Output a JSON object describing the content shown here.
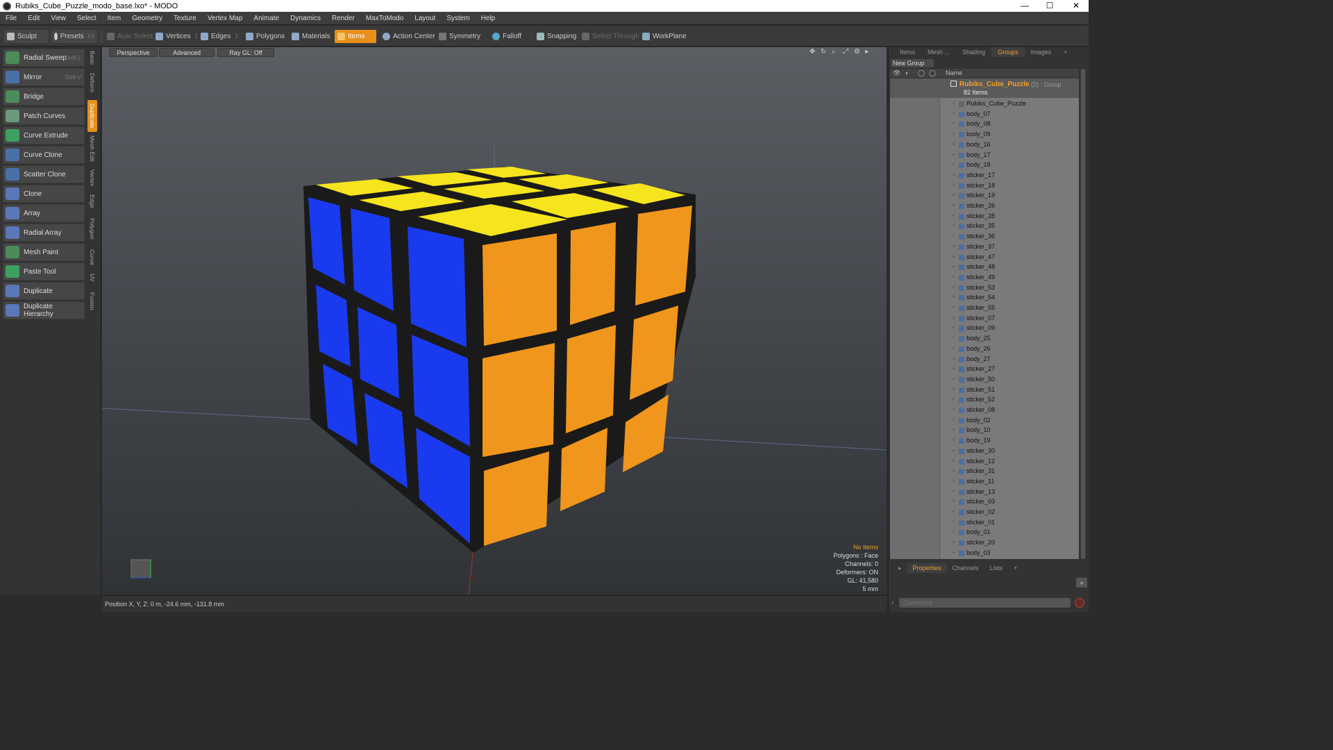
{
  "window": {
    "title": "Rubiks_Cube_Puzzle_modo_base.lxo* - MODO",
    "minimize": "—",
    "maximize": "☐",
    "close": "✕"
  },
  "menu": [
    "File",
    "Edit",
    "View",
    "Select",
    "Item",
    "Geometry",
    "Texture",
    "Vertex Map",
    "Animate",
    "Dynamics",
    "Render",
    "MaxToModo",
    "Layout",
    "System",
    "Help"
  ],
  "toolbar": {
    "sculpt": "Sculpt",
    "presets": "Presets",
    "presets_key": "F6",
    "auto_select": "Auto Select",
    "vertices": "Vertices",
    "vertices_key": "1",
    "edges": "Edges",
    "edges_key": "2",
    "polygons": "Polygons",
    "materials": "Materials",
    "items": "Items",
    "action_center": "Action Center",
    "symmetry": "Symmetry",
    "falloff": "Falloff",
    "snapping": "Snapping",
    "select_through": "Select Through",
    "workplane": "WorkPlane"
  },
  "tools": [
    {
      "label": "Radial Sweep",
      "shortcut": "Shift-L"
    },
    {
      "label": "Mirror",
      "shortcut": "Shift-V"
    },
    {
      "label": "Bridge",
      "shortcut": ""
    },
    {
      "label": "Patch Curves",
      "shortcut": ""
    },
    {
      "label": "Curve Extrude",
      "shortcut": ""
    },
    {
      "label": "Curve Clone",
      "shortcut": ""
    },
    {
      "label": "Scatter Clone",
      "shortcut": ""
    },
    {
      "label": "Clone",
      "shortcut": ""
    },
    {
      "label": "Array",
      "shortcut": ""
    },
    {
      "label": "Radial Array",
      "shortcut": ""
    },
    {
      "label": "Mesh Paint",
      "shortcut": ""
    },
    {
      "label": "Paste Tool",
      "shortcut": ""
    },
    {
      "label": "Duplicate",
      "shortcut": ""
    },
    {
      "label": "Duplicate Hierarchy",
      "shortcut": ""
    }
  ],
  "vertical_tabs": [
    "Basic",
    "Deform",
    "Duplicate",
    "Mesh Edit",
    "Vertex",
    "Edge",
    "Polygon",
    "Curve",
    "UV",
    "Fusion"
  ],
  "viewport": {
    "view": "Perspective",
    "shading": "Advanced",
    "raygl": "Ray GL: Off",
    "hud": {
      "selection": "No Items",
      "polygons": "Polygons : Face",
      "channels": "Channels: 0",
      "deformers": "Deformers: ON",
      "gl": "GL: 41,580",
      "scale": "5 mm"
    }
  },
  "status": {
    "position": "Position X, Y, Z:  0 m, -24.6 mm, -131.8 mm"
  },
  "right_tabs": [
    "Items",
    "Mesh ...",
    "Shading",
    "Groups",
    "Images",
    "+"
  ],
  "groups": {
    "new_group": "New Group",
    "column_name": "Name",
    "group_name": "Rubiks_Cube_Puzzle",
    "group_suffix": "(2) : Group",
    "count": "82 Items",
    "items": [
      "Rubiks_Cube_Puzzle",
      "body_07",
      "body_08",
      "body_09",
      "body_16",
      "body_17",
      "body_18",
      "sticker_17",
      "sticker_18",
      "sticker_19",
      "sticker_26",
      "sticker_28",
      "sticker_35",
      "sticker_36",
      "sticker_37",
      "sticker_47",
      "sticker_48",
      "sticker_49",
      "sticker_53",
      "sticker_54",
      "sticker_55",
      "sticker_07",
      "sticker_09",
      "body_25",
      "body_26",
      "body_27",
      "sticker_27",
      "sticker_50",
      "sticker_51",
      "sticker_52",
      "sticker_08",
      "body_02",
      "body_10",
      "body_19",
      "sticker_30",
      "sticker_12",
      "sticker_31",
      "sticker_11",
      "sticker_13",
      "sticker_03",
      "sticker_02",
      "sticker_01",
      "body_01",
      "sticker_20",
      "body_03"
    ]
  },
  "properties_tabs": [
    "Properties",
    "Channels",
    "Lists",
    "+"
  ],
  "command": {
    "placeholder": "Command"
  },
  "colors": {
    "accent": "#e8901b",
    "cube_top": "#f6e41e",
    "cube_left": "#1a3af0",
    "cube_right": "#f0961c"
  }
}
